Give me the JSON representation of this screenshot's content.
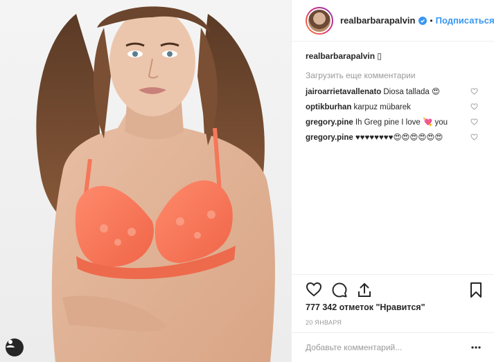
{
  "post": {
    "username": "realbarbarapalvin",
    "follow_label": "Подписаться",
    "dot": "•"
  },
  "caption": {
    "username": "realbarbarapalvin",
    "text": "▯"
  },
  "load_more": "Загрузить еще комментарии",
  "comments": [
    {
      "user": "jairoarrietavallenato",
      "text": "Diosa tallada 😍"
    },
    {
      "user": "optikburhan",
      "text": "karpuz mübarek"
    },
    {
      "user": "gregory.pine",
      "text": "Ih Greg pine I love 💘 you"
    },
    {
      "user": "gregory.pine",
      "text": "♥♥♥♥♥♥♥♥😍😍😍😍😍😍"
    }
  ],
  "likes": "777 342 отметок \"Нравится\"",
  "date": "20 ЯНВАРЯ",
  "add_comment": {
    "placeholder": "Добавьте комментарий..."
  },
  "colors": {
    "accent": "#3897f0",
    "text": "#262626",
    "muted": "#999999",
    "border": "#efefef",
    "bra": "#f7775a"
  },
  "icons": [
    "verified-badge-icon",
    "heart-icon",
    "comment-icon",
    "share-icon",
    "bookmark-icon",
    "more-options-icon",
    "tag-people-icon"
  ]
}
